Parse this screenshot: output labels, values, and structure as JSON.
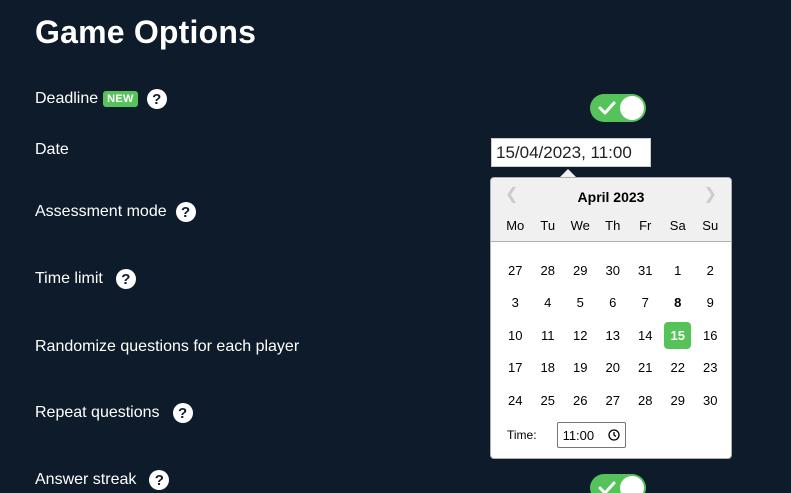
{
  "title": "Game Options",
  "options": {
    "deadline": {
      "label": "Deadline",
      "badge": "NEW",
      "enabled": true
    },
    "date": {
      "label": "Date",
      "value": "15/04/2023, 11:00"
    },
    "assessment_mode": {
      "label": "Assessment mode"
    },
    "time_limit": {
      "label": "Time limit"
    },
    "randomize": {
      "label": "Randomize questions for each player"
    },
    "repeat_questions": {
      "label": "Repeat questions"
    },
    "answer_streak": {
      "label": "Answer streak",
      "enabled": true
    }
  },
  "help_glyph": "?",
  "datepicker": {
    "month_label": "April 2023",
    "prev_glyph": "❮",
    "next_glyph": "❯",
    "weekdays": [
      "Mo",
      "Tu",
      "We",
      "Th",
      "Fr",
      "Sa",
      "Su"
    ],
    "weeks": [
      [
        "27",
        "28",
        "29",
        "30",
        "31",
        "1",
        "2"
      ],
      [
        "3",
        "4",
        "5",
        "6",
        "7",
        "8",
        "9"
      ],
      [
        "10",
        "11",
        "12",
        "13",
        "14",
        "15",
        "16"
      ],
      [
        "17",
        "18",
        "19",
        "20",
        "21",
        "22",
        "23"
      ],
      [
        "24",
        "25",
        "26",
        "27",
        "28",
        "29",
        "30"
      ]
    ],
    "selected_day": "15",
    "bold_day": "8",
    "time_label": "Time:",
    "time_value": "11:00"
  },
  "colors": {
    "background": "#0e1b2a",
    "accent": "#56c35a"
  },
  "icons": {
    "help": "help-icon",
    "toggle_check": "check-icon",
    "clock": "clock-icon"
  }
}
